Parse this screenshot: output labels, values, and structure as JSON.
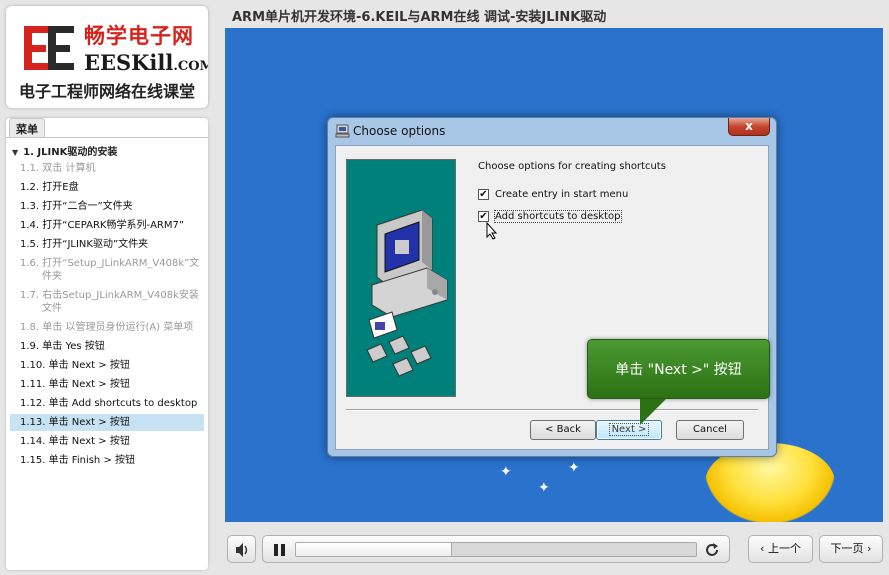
{
  "logo": {
    "brand_cn": "畅学电子网",
    "brand_en": "EESKill",
    "brand_domain": ".COM",
    "subtitle": "电子工程师网络在线课堂"
  },
  "menu": {
    "tab_label": "菜单",
    "section_title": "1. JLINK驱动的安装",
    "items": [
      {
        "label": "1.1.  双击 计算机",
        "state": "visited"
      },
      {
        "label": "1.2.  打开E盘",
        "state": "normal"
      },
      {
        "label": "1.3.  打开“二合一”文件夹",
        "state": "normal"
      },
      {
        "label": "1.4.  打开“CEPARK畅学系列-ARM7”",
        "state": "normal"
      },
      {
        "label": "1.5.  打开“JLINK驱动”文件夹",
        "state": "normal"
      },
      {
        "label": "1.6.  打开“Setup_JLinkARM_V408k”文件夹",
        "state": "visited"
      },
      {
        "label": "1.7.  右击Setup_JLinkARM_V408k安装文件",
        "state": "visited"
      },
      {
        "label": "1.8.  单击 以管理员身份运行(A) 菜单项",
        "state": "visited"
      },
      {
        "label": "1.9.  单击 Yes 按钮",
        "state": "normal"
      },
      {
        "label": "1.10.  单击 Next > 按钮",
        "state": "normal"
      },
      {
        "label": "1.11.  单击 Next > 按钮",
        "state": "normal"
      },
      {
        "label": "1.12.  单击 Add shortcuts to desktop",
        "state": "normal"
      },
      {
        "label": "1.13.  单击 Next > 按钮",
        "state": "selected"
      },
      {
        "label": "1.14.  单击 Next > 按钮",
        "state": "normal"
      },
      {
        "label": "1.15.  单击 Finish > 按钮",
        "state": "normal"
      }
    ]
  },
  "header": {
    "title": "ARM单片机开发环境-6.KEIL与ARM在线 调试-安装JLINK驱动"
  },
  "dialog": {
    "title": "Choose options",
    "close_label": "x",
    "heading": "Choose options for creating shortcuts",
    "options": [
      {
        "label": "Create entry in start menu",
        "checked": true
      },
      {
        "label": "Add shortcuts to desktop",
        "checked": true
      }
    ],
    "back_label": "< Back",
    "next_label": "Next >",
    "cancel_label": "Cancel"
  },
  "callout": {
    "text": "单击 \"Next >\" 按钮"
  },
  "player": {
    "progress_percent": 39
  },
  "nav": {
    "prev_label": "上一个",
    "next_label": "下一页"
  },
  "colors": {
    "video_bg": "#2a72cc",
    "callout_green": "#3a8a22",
    "teal_panel": "#00807a",
    "selected_row": "#c7e3f3",
    "brand_red": "#d6231d"
  },
  "icons": [
    "volume-icon",
    "pause-icon",
    "replay-icon",
    "chevron-left-icon",
    "chevron-right-icon",
    "computer-icon",
    "pointer-cursor-icon"
  ]
}
